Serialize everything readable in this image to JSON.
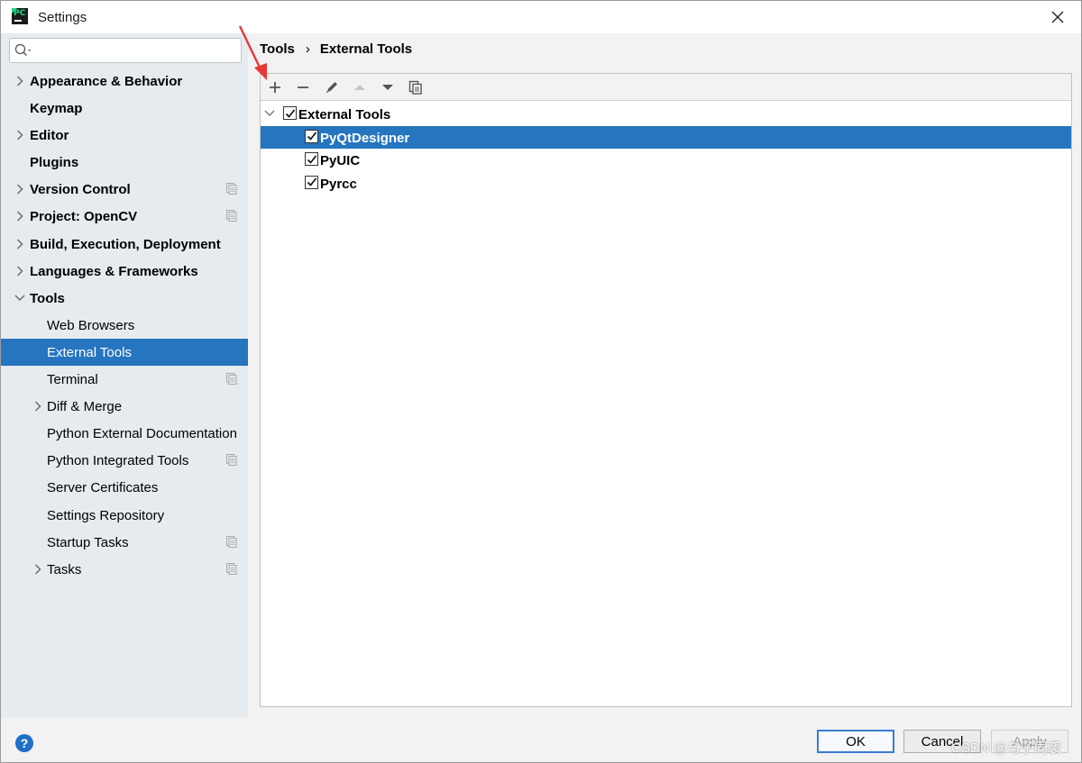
{
  "window": {
    "title": "Settings"
  },
  "search": {
    "placeholder": ""
  },
  "sidebar": {
    "items": [
      {
        "label": "Appearance & Behavior",
        "level": 0,
        "expandable": true,
        "expanded": false,
        "bold": true,
        "project_icon": false,
        "selected": false
      },
      {
        "label": "Keymap",
        "level": 0,
        "expandable": false,
        "bold": true,
        "project_icon": false,
        "selected": false
      },
      {
        "label": "Editor",
        "level": 0,
        "expandable": true,
        "expanded": false,
        "bold": true,
        "project_icon": false,
        "selected": false
      },
      {
        "label": "Plugins",
        "level": 0,
        "expandable": false,
        "bold": true,
        "project_icon": false,
        "selected": false
      },
      {
        "label": "Version Control",
        "level": 0,
        "expandable": true,
        "expanded": false,
        "bold": true,
        "project_icon": true,
        "selected": false
      },
      {
        "label": "Project: OpenCV",
        "level": 0,
        "expandable": true,
        "expanded": false,
        "bold": true,
        "project_icon": true,
        "selected": false
      },
      {
        "label": "Build, Execution, Deployment",
        "level": 0,
        "expandable": true,
        "expanded": false,
        "bold": true,
        "project_icon": false,
        "selected": false
      },
      {
        "label": "Languages & Frameworks",
        "level": 0,
        "expandable": true,
        "expanded": false,
        "bold": true,
        "project_icon": false,
        "selected": false
      },
      {
        "label": "Tools",
        "level": 0,
        "expandable": true,
        "expanded": true,
        "bold": true,
        "project_icon": false,
        "selected": false
      },
      {
        "label": "Web Browsers",
        "level": 1,
        "expandable": false,
        "bold": false,
        "project_icon": false,
        "selected": false
      },
      {
        "label": "External Tools",
        "level": 1,
        "expandable": false,
        "bold": false,
        "project_icon": false,
        "selected": true
      },
      {
        "label": "Terminal",
        "level": 1,
        "expandable": false,
        "bold": false,
        "project_icon": true,
        "selected": false
      },
      {
        "label": "Diff & Merge",
        "level": 1,
        "expandable": true,
        "expanded": false,
        "bold": false,
        "project_icon": false,
        "selected": false
      },
      {
        "label": "Python External Documentation",
        "level": 1,
        "expandable": false,
        "bold": false,
        "project_icon": false,
        "selected": false
      },
      {
        "label": "Python Integrated Tools",
        "level": 1,
        "expandable": false,
        "bold": false,
        "project_icon": true,
        "selected": false
      },
      {
        "label": "Server Certificates",
        "level": 1,
        "expandable": false,
        "bold": false,
        "project_icon": false,
        "selected": false
      },
      {
        "label": "Settings Repository",
        "level": 1,
        "expandable": false,
        "bold": false,
        "project_icon": false,
        "selected": false
      },
      {
        "label": "Startup Tasks",
        "level": 1,
        "expandable": false,
        "bold": false,
        "project_icon": true,
        "selected": false
      },
      {
        "label": "Tasks",
        "level": 1,
        "expandable": true,
        "expanded": false,
        "bold": false,
        "project_icon": true,
        "selected": false
      }
    ]
  },
  "breadcrumb": {
    "parent": "Tools",
    "separator": "›",
    "current": "External Tools"
  },
  "toolbar": {
    "icons": [
      "add-icon",
      "remove-icon",
      "edit-icon",
      "move-up-icon",
      "move-down-icon",
      "copy-icon"
    ]
  },
  "tools_tree": {
    "group": {
      "label": "External Tools",
      "checked": true,
      "expanded": true
    },
    "items": [
      {
        "label": "PyQtDesigner",
        "checked": true,
        "selected": true
      },
      {
        "label": "PyUIC",
        "checked": true,
        "selected": false
      },
      {
        "label": "Pyrcc",
        "checked": true,
        "selected": false
      }
    ]
  },
  "footer": {
    "help": "?",
    "ok": "OK",
    "cancel": "Cancel",
    "apply": "Apply",
    "watermark": "CSDN @与子同袭"
  },
  "colors": {
    "selection": "#2675bf",
    "sidebar_bg": "#e6ebf0",
    "annotation_arrow": "#e53935"
  }
}
